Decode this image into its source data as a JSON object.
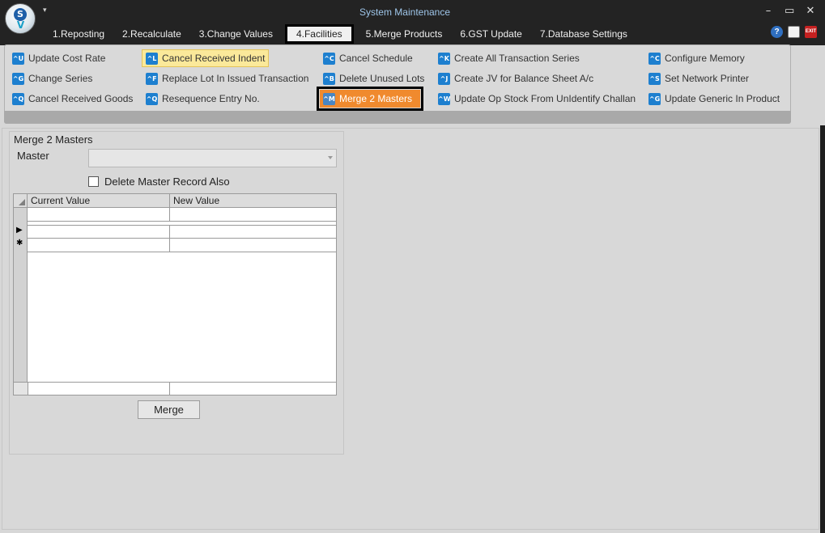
{
  "window": {
    "title": "System Maintenance",
    "logo_letters": [
      "S",
      "V"
    ]
  },
  "window_buttons": {
    "minimize": "–",
    "maximize": "▭",
    "close": "✕"
  },
  "quick_access": {
    "glyph": "▾"
  },
  "tabs": [
    {
      "label": "1.Reposting"
    },
    {
      "label": "2.Recalculate"
    },
    {
      "label": "3.Change Values"
    },
    {
      "label": "4.Facilities",
      "active": true
    },
    {
      "label": "5.Merge Products"
    },
    {
      "label": "6.GST Update"
    },
    {
      "label": "7.Database Settings"
    }
  ],
  "right_icons": {
    "help_glyph": "?",
    "exit_label": "EXIT"
  },
  "ribbon": {
    "col1": [
      {
        "label": "Update Cost Rate",
        "icon": "^U"
      },
      {
        "label": "Change Series",
        "icon": "^G"
      },
      {
        "label": "Cancel Received Goods",
        "icon": "^Q"
      }
    ],
    "col2": [
      {
        "label": "Cancel Received Indent",
        "icon": "^L"
      },
      {
        "label": "Replace Lot In Issued Transaction",
        "icon": "^F"
      },
      {
        "label": "Resequence Entry No.",
        "icon": "^Q"
      }
    ],
    "col3": [
      {
        "label": "Cancel Schedule",
        "icon": "^C"
      },
      {
        "label": "Delete Unused Lots",
        "icon": "^B"
      },
      {
        "label": "Merge 2 Masters",
        "icon": "^M"
      }
    ],
    "col4": [
      {
        "label": "Create All Transaction Series",
        "icon": "^K"
      },
      {
        "label": "Create JV for Balance Sheet A/c",
        "icon": "^J"
      },
      {
        "label": "Update Op Stock From UnIdentify Challan",
        "icon": "^W"
      }
    ],
    "col5": [
      {
        "label": "Configure Memory",
        "icon": "^C"
      },
      {
        "label": "Set Network Printer",
        "icon": "^S"
      },
      {
        "label": "Update Generic In Product",
        "icon": "^G"
      }
    ]
  },
  "form": {
    "group_title": "Merge 2 Masters",
    "master_label": "Master",
    "master_value": "",
    "delete_checkbox_label": "Delete Master Record Also",
    "grid": {
      "columns": [
        "Current Value",
        "New Value"
      ],
      "row_markers": {
        "current": "▶",
        "new": "✱"
      }
    },
    "merge_button": "Merge"
  },
  "colors": {
    "selected_bg": "#f08a2e",
    "hover_bg": "#fbe99a",
    "icon_blue": "#1d7fcf",
    "title_text": "#9fc6ea"
  }
}
